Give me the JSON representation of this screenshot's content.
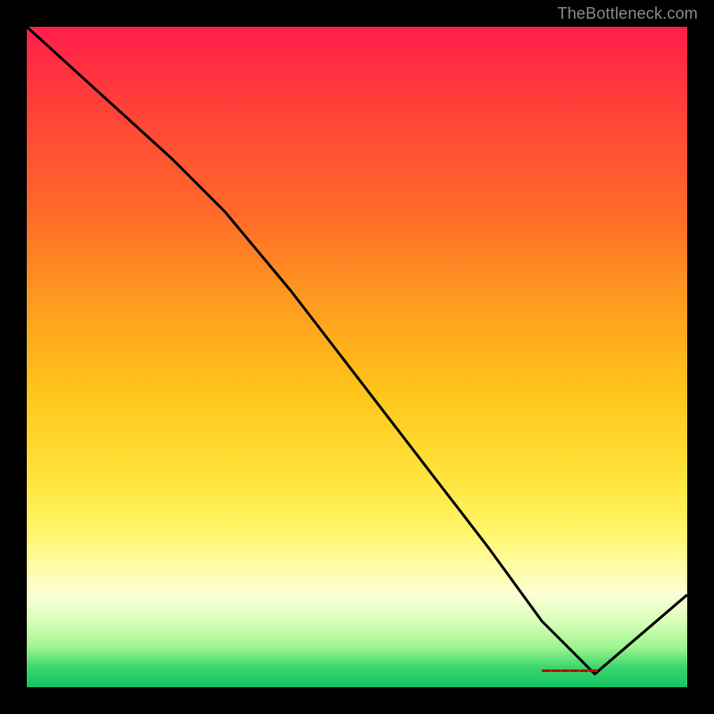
{
  "watermark": "TheBottleneck.com",
  "baseline_marker_text": "▬▬▬▬▬▬",
  "chart_data": {
    "type": "line",
    "title": "",
    "xlabel": "",
    "ylabel": "",
    "xlim": [
      0,
      100
    ],
    "ylim": [
      0,
      100
    ],
    "grid": false,
    "series": [
      {
        "name": "curve",
        "x": [
          0,
          22,
          30,
          40,
          50,
          60,
          70,
          78,
          86,
          100
        ],
        "values": [
          100,
          80,
          72,
          60,
          47,
          34,
          21,
          10,
          2,
          14
        ]
      }
    ],
    "gradient_stops": [
      {
        "pct": 0,
        "color": "#ff1e4c"
      },
      {
        "pct": 10,
        "color": "#ff3b3b"
      },
      {
        "pct": 28,
        "color": "#ff6a2a"
      },
      {
        "pct": 42,
        "color": "#ff9c1f"
      },
      {
        "pct": 55,
        "color": "#ffc41a"
      },
      {
        "pct": 68,
        "color": "#ffe33a"
      },
      {
        "pct": 76,
        "color": "#fff566"
      },
      {
        "pct": 82,
        "color": "#fffca8"
      },
      {
        "pct": 86,
        "color": "#fbffd6"
      },
      {
        "pct": 90,
        "color": "#d9ffb8"
      },
      {
        "pct": 94,
        "color": "#9cf58e"
      },
      {
        "pct": 97,
        "color": "#3bd66e"
      },
      {
        "pct": 100,
        "color": "#14c463"
      }
    ],
    "baseline_marker": {
      "x_start": 78,
      "x_end": 89,
      "y": 2.5
    }
  }
}
